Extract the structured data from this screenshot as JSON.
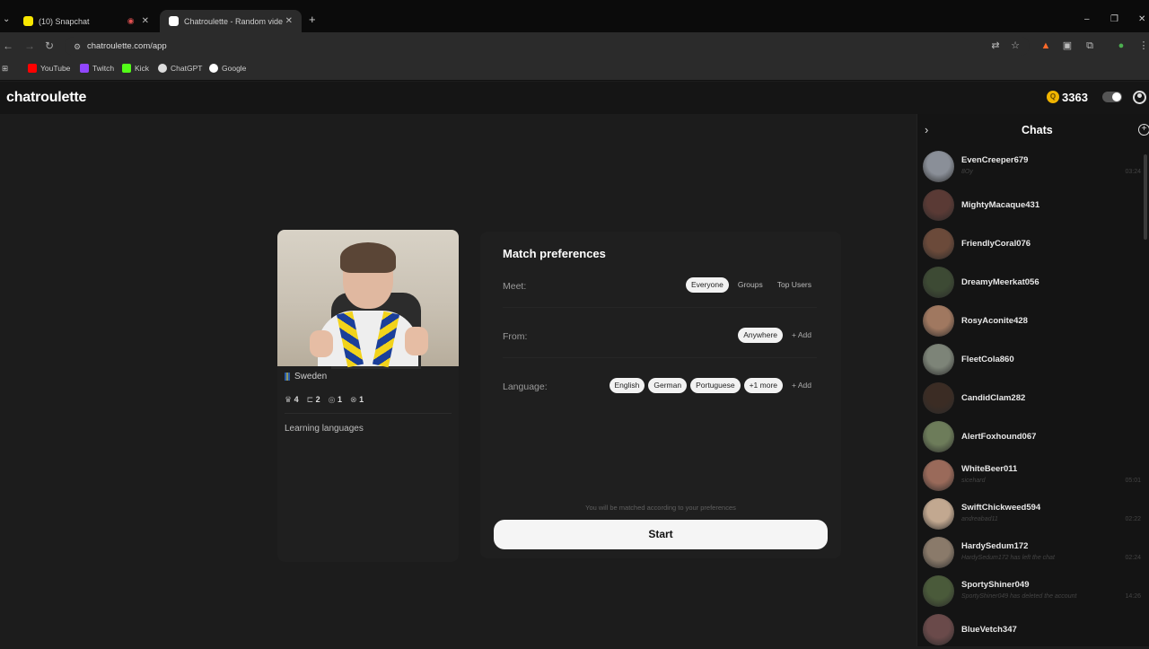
{
  "browser": {
    "tabs": [
      {
        "title": "(10) Snapchat"
      },
      {
        "title": "Chatroulette - Random video c"
      }
    ],
    "url": "chatroulette.com/app",
    "bookmarks": [
      "YouTube",
      "Twitch",
      "Kick",
      "ChatGPT",
      "Google"
    ]
  },
  "app": {
    "logo": "chatroulette",
    "coins": "3363",
    "coin_glyph": "Q"
  },
  "profile": {
    "country": "Sweden",
    "stats": [
      "4",
      "2",
      "1",
      "1"
    ],
    "bio": "Learning languages"
  },
  "prefs": {
    "title": "Match preferences",
    "meet_label": "Meet:",
    "meet_options": [
      "Everyone",
      "Groups",
      "Top Users"
    ],
    "from_label": "From:",
    "from_selected": "Anywhere",
    "add": "+ Add",
    "language_label": "Language:",
    "languages": [
      "English",
      "German",
      "Portuguese",
      "+1 more"
    ],
    "hint": "You will be matched according to your preferences",
    "start": "Start"
  },
  "chats": {
    "title": "Chats",
    "items": [
      {
        "name": "EvenCreeper679",
        "msg": "8Oy",
        "time": "03:24",
        "color": "#8a8f98"
      },
      {
        "name": "MightyMacaque431",
        "msg": "",
        "time": "",
        "color": "#5a3a35"
      },
      {
        "name": "FriendlyCoral076",
        "msg": "",
        "time": "",
        "color": "#6b4a3a"
      },
      {
        "name": "DreamyMeerkat056",
        "msg": "",
        "time": "",
        "color": "#3d4a34"
      },
      {
        "name": "RosyAconite428",
        "msg": "",
        "time": "",
        "color": "#a07860"
      },
      {
        "name": "FleetCola860",
        "msg": "",
        "time": "",
        "color": "#7d8478"
      },
      {
        "name": "CandidClam282",
        "msg": "",
        "time": "",
        "color": "#3b2c24"
      },
      {
        "name": "AlertFoxhound067",
        "msg": "",
        "time": "",
        "color": "#6d7c5a"
      },
      {
        "name": "WhiteBeer011",
        "msg": "sicehard",
        "time": "05:01",
        "color": "#9a6a5a"
      },
      {
        "name": "SwiftChickweed594",
        "msg": "andreabad11",
        "time": "02:22",
        "color": "#c2a890"
      },
      {
        "name": "HardySedum172",
        "msg": "HardySedum172 has left the chat",
        "time": "02:24",
        "color": "#8a7a6a"
      },
      {
        "name": "SportyShiner049",
        "msg": "SportyShiner049 has deleted the account",
        "time": "14:26",
        "color": "#4a5a3a"
      },
      {
        "name": "BlueVetch347",
        "msg": "",
        "time": "",
        "color": "#6a4a4a"
      }
    ]
  }
}
